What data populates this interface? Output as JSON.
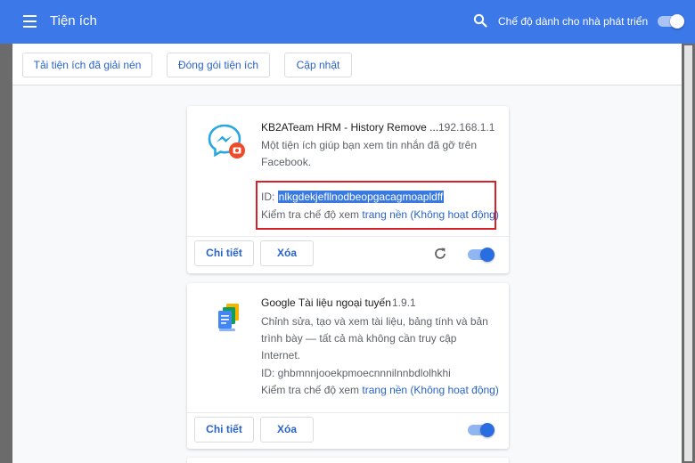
{
  "header": {
    "title": "Tiện ích",
    "dev_mode_label": "Chế độ dành cho nhà phát triển",
    "dev_mode_on": true
  },
  "toolbar": {
    "load_unpacked": "Tải tiện ích đã giải nén",
    "pack": "Đóng gói tiện ích",
    "update": "Cập nhật"
  },
  "extensions": [
    {
      "name": "KB2ATeam HRM - History Remove ...",
      "version": "192.168.1.1",
      "description": "Một tiện ích giúp bạn xem tin nhắn đã gỡ trên Facebook.",
      "id_label": "ID: ",
      "id": "nlkgdekjefllnodbeopgacagmoapldff",
      "inspect_label": "Kiểm tra chế độ xem ",
      "inspect_link": "trang nền (Không hoạt động)",
      "details": "Chi tiết",
      "remove": "Xóa",
      "enabled": true,
      "icon": "messenger-icon"
    },
    {
      "name": "Google Tài liệu ngoại tuyến",
      "version": "1.9.1",
      "description": "Chỉnh sửa, tạo và xem tài liệu, bảng tính và bản trình bày — tất cả mà không cần truy cập Internet.",
      "id_label": "ID: ",
      "id": "ghbmnnjooekpmoecnnnilnnbdlolhkhi",
      "inspect_label": "Kiểm tra chế độ xem ",
      "inspect_link": "trang nền (Không hoạt động)",
      "details": "Chi tiết",
      "remove": "Xóa",
      "enabled": true,
      "icon": "google-docs-icon"
    }
  ]
}
